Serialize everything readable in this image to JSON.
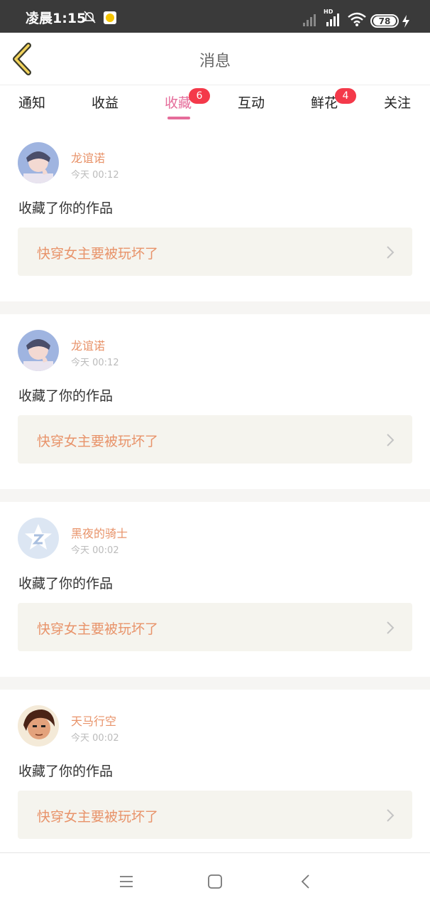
{
  "status_bar": {
    "time": "凌晨1:15",
    "network_label": "HD",
    "battery_level": "78"
  },
  "header": {
    "title": "消息"
  },
  "tabs": [
    {
      "label": "通知",
      "badge": null,
      "active": false
    },
    {
      "label": "收益",
      "badge": null,
      "active": false
    },
    {
      "label": "收藏",
      "badge": "6",
      "active": true
    },
    {
      "label": "互动",
      "badge": null,
      "active": false
    },
    {
      "label": "鲜花",
      "badge": "4",
      "active": false
    },
    {
      "label": "关注",
      "badge": null,
      "active": false
    }
  ],
  "messages": [
    {
      "username": "龙谊诺",
      "time": "今天 00:12",
      "action": "收藏了你的作品",
      "work_title": "快穿女主要被玩坏了",
      "avatar": "anime-boy-avatar"
    },
    {
      "username": "龙谊诺",
      "time": "今天 00:12",
      "action": "收藏了你的作品",
      "work_title": "快穿女主要被玩坏了",
      "avatar": "anime-boy-avatar"
    },
    {
      "username": "黑夜的骑士",
      "time": "今天 00:02",
      "action": "收藏了你的作品",
      "work_title": "快穿女主要被玩坏了",
      "avatar": "default-star-avatar"
    },
    {
      "username": "天马行空",
      "time": "今天 00:02",
      "action": "收藏了你的作品",
      "work_title": "快穿女主要被玩坏了",
      "avatar": "cartoon-man-avatar"
    }
  ],
  "colors": {
    "accent_pink": "#e56c9a",
    "username_orange": "#e8936a",
    "badge_red": "#f4394a",
    "work_card_bg": "#f5f4ee",
    "status_bar_bg": "#3a3a3a"
  },
  "icons": {
    "back": "back-chevron-icon",
    "work_arrow": "chevron-right-icon",
    "nav_menu": "menu-icon",
    "nav_home": "home-square-icon",
    "nav_back": "back-icon"
  }
}
